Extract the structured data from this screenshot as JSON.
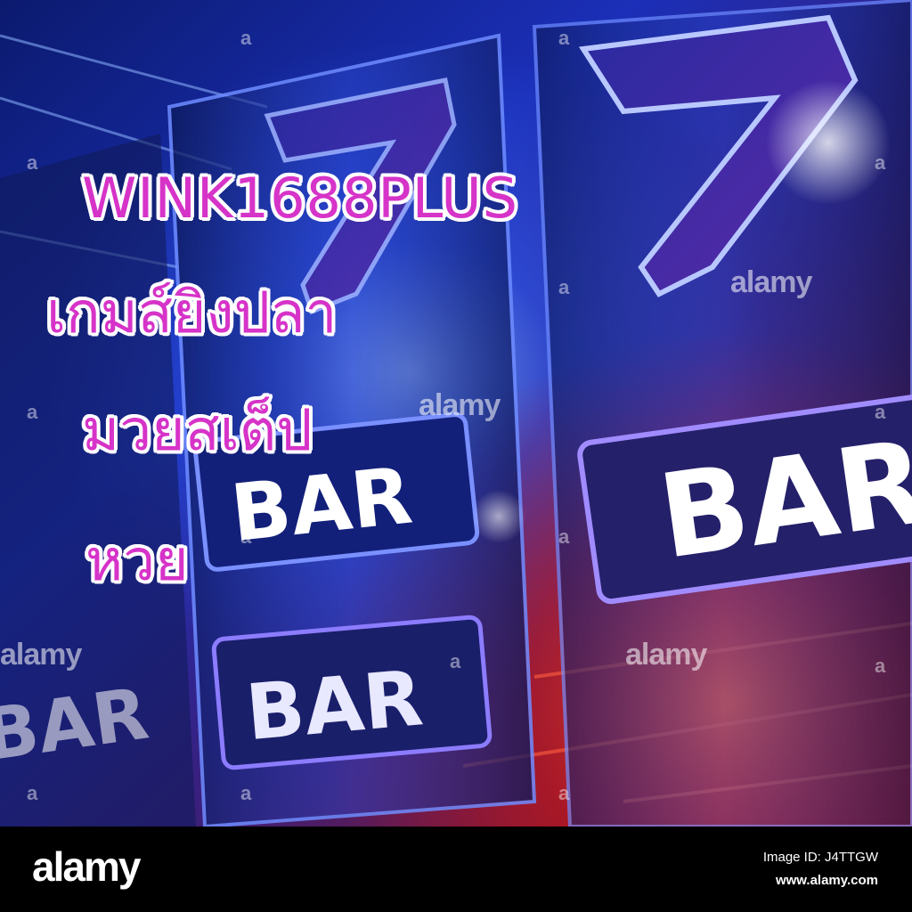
{
  "overlay": {
    "headline": "WINK1688PLUS",
    "line1": "เกมส์ยิงปลา",
    "line2": "มวยสเต็ป",
    "line3": "หวย",
    "text_color": "#d633c8",
    "outline_color": "#ffffff"
  },
  "scene": {
    "reel_symbols": [
      "7",
      "BAR"
    ],
    "bar_label": "BAR",
    "seven_label": "7"
  },
  "watermark": {
    "word": "alamy",
    "letter": "a"
  },
  "footer": {
    "logo": "alamy",
    "image_id": "Image ID: J4TTGW",
    "url": "www.alamy.com",
    "background": "#000000"
  },
  "colors": {
    "blue": "#1a3fd1",
    "purple": "#4a1f8a",
    "red": "#e0201a",
    "dark": "#0a0a20"
  }
}
